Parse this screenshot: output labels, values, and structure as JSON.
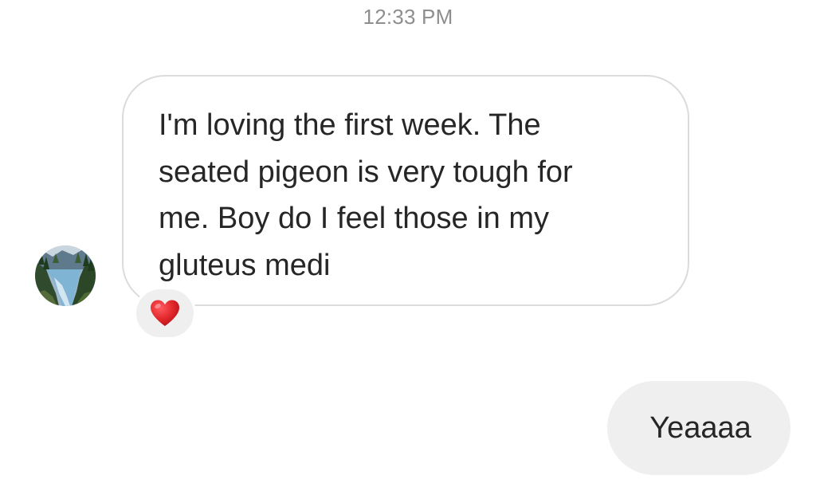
{
  "conversation": {
    "timestamp": "12:33 PM",
    "messages": [
      {
        "direction": "incoming",
        "sender_avatar_icon": "river-forest-avatar",
        "text": "I'm loving the first week. The\nseated pigeon is very tough for\nme. Boy do I feel those in my\ngluteus medi",
        "reaction": {
          "icon": "red-heart-icon",
          "color": "#e0262a"
        }
      },
      {
        "direction": "outgoing",
        "text": "Yeaaaa"
      }
    ]
  },
  "colors": {
    "incoming_bubble_border": "#dbdbdb",
    "outgoing_bubble_bg": "#efefef",
    "timestamp_text": "#8e8e8e",
    "message_text": "#262626"
  }
}
